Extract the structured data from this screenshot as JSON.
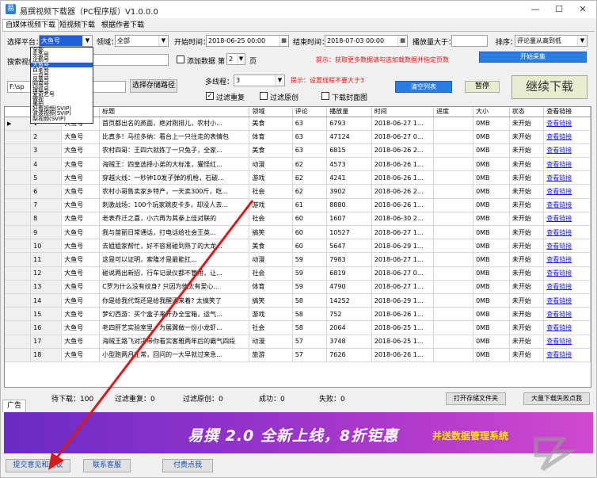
{
  "window": {
    "title": "易撰视频下载器（PC程序版）V1.0.0.0",
    "min": "—",
    "max": "☐",
    "close": "✕"
  },
  "tabs": [
    "自媒体视频下载",
    "短视频下载",
    "根据作者下载"
  ],
  "filters": {
    "platform_label": "选择平台：",
    "platform_value": "大鱼号",
    "domain_label": "领域：",
    "domain_value": "全部",
    "start_label": "开始时间：",
    "start_value": "2018-06-25 00:00",
    "end_label": "结束时间：",
    "end_value": "2018-07-03 00:00",
    "play_label": "播放量大于：",
    "play_value": "",
    "sort_label": "排序：",
    "sort_value": "评论量从高到低",
    "search_label": "搜索视频：",
    "search_value": "",
    "add_data_label": "添加数据",
    "page_prefix": "第",
    "page_value": "2",
    "page_suffix": "页",
    "tip": "提示：获取更多数据请勾选加载数据并指定页数",
    "start_collect": "开始采集"
  },
  "platform_options": [
    "全部",
    "头条号",
    "企鹅号",
    "大鱼号",
    "百家号",
    "一点号",
    "凤凰号",
    "网易号",
    "搜狐号",
    "爱奇艺号",
    "微视",
    "美拍",
    "好看视频(SVIP)",
    "波波视频(SVIP)",
    "梨视频(SVIP)"
  ],
  "download": {
    "path_value": "F:\\sp",
    "path_button": "选择存储路径",
    "threads_label": "多线程：",
    "threads_value": "3",
    "threads_tip": "提示：设置线程不要大于3",
    "clear_list": "清空列表",
    "pause": "暂停",
    "continue": "继续下载",
    "filter_dup": "过滤重复",
    "filter_orig": "过滤原创",
    "download_cover": "下载封面图"
  },
  "table": {
    "columns": [
      "序号",
      "平台",
      "标题",
      "领域",
      "评论",
      "播放量",
      "时间",
      "进度",
      "大小",
      "状态",
      "查看链接"
    ],
    "rows": [
      [
        "1",
        "大鱼号",
        "首页都出名的燕面，绝对刚排儿，农村小...",
        "美食",
        "63",
        "6793",
        "2018-06-27 1...",
        "",
        "0MB",
        "未开始",
        "查看链接"
      ],
      [
        "2",
        "大鱼号",
        "比真多！马拉多纳：看台上一只往走的表情包",
        "体育",
        "63",
        "47124",
        "2018-06-27 0...",
        "",
        "0MB",
        "未开始",
        "查看链接"
      ],
      [
        "3",
        "大鱼号",
        "农村四哥：王四六就拣了一只兔子，全家...",
        "美食",
        "63",
        "6815",
        "2018-06-26 2...",
        "",
        "0MB",
        "未开始",
        "查看链接"
      ],
      [
        "4",
        "大鱼号",
        "海贼王：四皇选择小弟的大标准，獾怪红...",
        "动漫",
        "62",
        "4573",
        "2018-06-26 1...",
        "",
        "0MB",
        "未开始",
        "查看链接"
      ],
      [
        "5",
        "大鱼号",
        "穿越火线：一秒钟10发子弹的机枪，石破...",
        "游戏",
        "62",
        "4241",
        "2018-06-26 1...",
        "",
        "0MB",
        "未开始",
        "查看链接"
      ],
      [
        "6",
        "大鱼号",
        "农村小哥售卖家乡特产，一天卖300斤，吃...",
        "社会",
        "62",
        "3902",
        "2018-06-26 2...",
        "",
        "0MB",
        "未开始",
        "查看链接"
      ],
      [
        "7",
        "大鱼号",
        "刺激战场：100个玩家跳皮卡多，却没人去...",
        "游戏",
        "61",
        "8880",
        "2018-06-26 1...",
        "",
        "0MB",
        "未开始",
        "查看链接"
      ],
      [
        "8",
        "大鱼号",
        "老表乔迁之喜，小六再为其拳上佳对联的",
        "社会",
        "60",
        "1607",
        "2018-06-30 2...",
        "",
        "0MB",
        "未开始",
        "查看链接"
      ],
      [
        "9",
        "大鱼号",
        "我与苗丽日常通话，打电话给社会王英...",
        "搞笑",
        "60",
        "10527",
        "2018-06-27 1...",
        "",
        "0MB",
        "未开始",
        "查看链接"
      ],
      [
        "10",
        "大鱼号",
        "去姐姐家帮忙，好不容易碰到熟了的大龙...",
        "美食",
        "60",
        "5647",
        "2018-06-29 1...",
        "",
        "0MB",
        "未开始",
        "查看链接"
      ],
      [
        "11",
        "大鱼号",
        "这是可以证明，索隆才是最能扛...",
        "动漫",
        "59",
        "7983",
        "2018-06-27 1...",
        "",
        "0MB",
        "未开始",
        "查看链接"
      ],
      [
        "12",
        "大鱼号",
        "碰说两出新招，行车记录仪都不管用，让...",
        "社会",
        "59",
        "6819",
        "2018-06-27 0...",
        "",
        "0MB",
        "未开始",
        "查看链接"
      ],
      [
        "13",
        "大鱼号",
        "C罗为什么没有纹身? 只因为他太有爱心...",
        "体育",
        "59",
        "4790",
        "2018-06-27 1...",
        "",
        "0MB",
        "未开始",
        "查看链接"
      ],
      [
        "14",
        "大鱼号",
        "你是给我代驾还是给我醒酒来着? 太搞笑了",
        "搞笑",
        "58",
        "14252",
        "2018-06-29 1...",
        "",
        "0MB",
        "未开始",
        "查看链接"
      ],
      [
        "15",
        "大鱼号",
        "梦幻西游：买个盒子来开办全宝箱，运气...",
        "游戏",
        "58",
        "752",
        "2018-06-26 1...",
        "",
        "0MB",
        "未开始",
        "查看链接"
      ],
      [
        "16",
        "大鱼号",
        "老四肝艺实验室里，为展翼做一份小龙虾...",
        "社会",
        "58",
        "2064",
        "2018-06-25 1...",
        "",
        "0MB",
        "未开始",
        "查看链接"
      ],
      [
        "17",
        "大鱼号",
        "海贼王路飞对决带你看实客雅两年后的霸气四段",
        "动漫",
        "57",
        "3748",
        "2018-06-25 1...",
        "",
        "0MB",
        "未开始",
        "查看链接"
      ],
      [
        "18",
        "大鱼号",
        "小型跑两月正常，回问的一大早就过来急...",
        "旅游",
        "57",
        "7626",
        "2018-06-26 1...",
        "",
        "0MB",
        "未开始",
        "查看链接"
      ]
    ]
  },
  "status": {
    "pending": "待下载：100",
    "dup": "过滤重复：0",
    "orig": "过滤原创：0",
    "success": "成功：0",
    "fail": "失败：0",
    "open_folder": "打开存储文件夹",
    "batch_fail": "大量下载失败点我"
  },
  "ad": {
    "tab": "广告",
    "banner_main": "易撰 2.0 全新上线，8折钜惠",
    "banner_sub": "并送数据管理系统"
  },
  "bottom": {
    "feedback": "提交意见和建议",
    "support": "联系客服",
    "pay": "付费点我"
  },
  "colors": {
    "accent_blue": "#2b7de6",
    "tip_red": "#e21b1b",
    "banner_start": "#6a2cc4",
    "banner_end": "#d049cf",
    "link_blue": "#1a1aee"
  }
}
